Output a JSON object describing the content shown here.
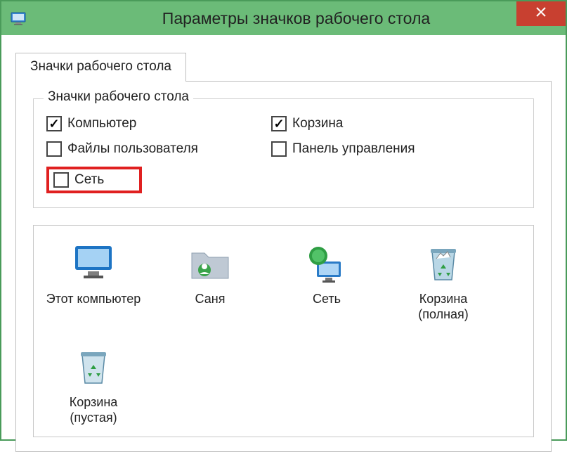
{
  "window": {
    "title": "Параметры значков рабочего стола"
  },
  "tab": {
    "label": "Значки рабочего стола"
  },
  "group": {
    "legend": "Значки рабочего стола",
    "checks": {
      "computer": {
        "label": "Компьютер",
        "checked": true
      },
      "recycle": {
        "label": "Корзина",
        "checked": true
      },
      "userfiles": {
        "label": "Файлы пользователя",
        "checked": false
      },
      "cpanel": {
        "label": "Панель управления",
        "checked": false
      },
      "network": {
        "label": "Сеть",
        "checked": false
      }
    }
  },
  "icons": {
    "thispc": {
      "label": "Этот компьютер"
    },
    "user": {
      "label": "Саня"
    },
    "net": {
      "label": "Сеть"
    },
    "bin_full": {
      "label": "Корзина (полная)"
    },
    "bin_empty": {
      "label": "Корзина (пустая)"
    }
  }
}
